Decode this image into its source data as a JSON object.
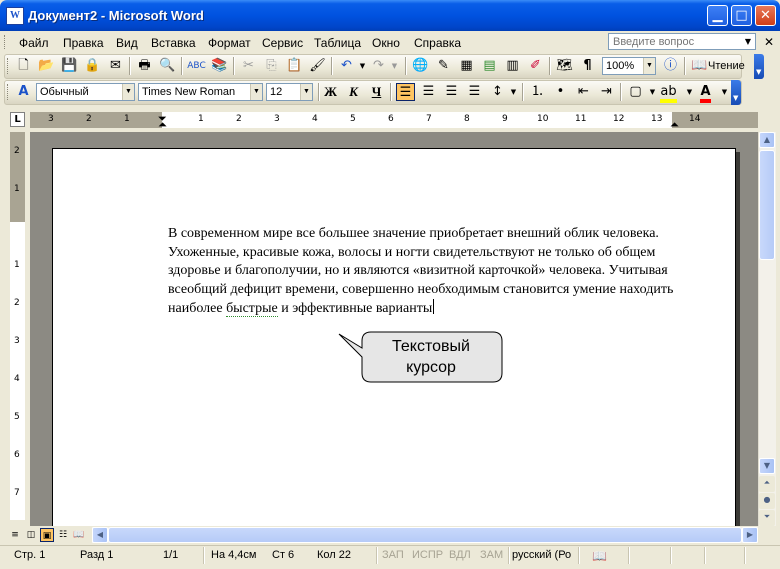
{
  "window": {
    "title": "Документ2 - Microsoft Word",
    "app_icon": "W",
    "minimize_glyph": "▁",
    "maximize_glyph": "□",
    "close_glyph": "✕"
  },
  "menu": {
    "items": [
      "Файл",
      "Правка",
      "Вид",
      "Вставка",
      "Формат",
      "Сервис",
      "Таблица",
      "Окно",
      "Справка"
    ],
    "ask_placeholder": "Введите вопрос"
  },
  "standard_toolbar": {
    "zoom": "100%",
    "read_label": "Чтение",
    "paragraph_mark": "¶"
  },
  "format_toolbar": {
    "style": "Обычный",
    "font": "Times New Roman",
    "size": "12",
    "bold": "Ж",
    "italic": "К",
    "underline": "Ч"
  },
  "ruler": {
    "corner": "L",
    "h_numbers": [
      "3",
      "2",
      "1",
      "1",
      "2",
      "3",
      "4",
      "5",
      "6",
      "7",
      "8",
      "9",
      "10",
      "11",
      "12",
      "13",
      "14"
    ],
    "v_numbers": [
      "2",
      "1",
      "1",
      "2",
      "3",
      "4",
      "5",
      "6",
      "7"
    ]
  },
  "document": {
    "text": "В современном мире все большее значение приобретает внешний облик человека. Ухоженные, красивые кожа, волосы и ногти свидетельствуют не только об общем здоровье и благополучии, но и являются «визитной карточкой» человека. Учитывая всеобщий дефицит времени, совершенно необходимым становится умение находить наиболее ",
    "squiggle_word": "быстрые",
    "text_after": " и эффективные варианты"
  },
  "callout": {
    "line1": "Текстовый",
    "line2": "курсор"
  },
  "status": {
    "page": "Стр.  1",
    "section": "Разд  1",
    "pages": "1/1",
    "at": "На 4,4см",
    "line": "Ст  6",
    "col": "Кол  22",
    "rec": "ЗАП",
    "trk": "ИСПР",
    "ext": "ВДЛ",
    "ovr": "ЗАМ",
    "lang": "русский (Ро"
  }
}
